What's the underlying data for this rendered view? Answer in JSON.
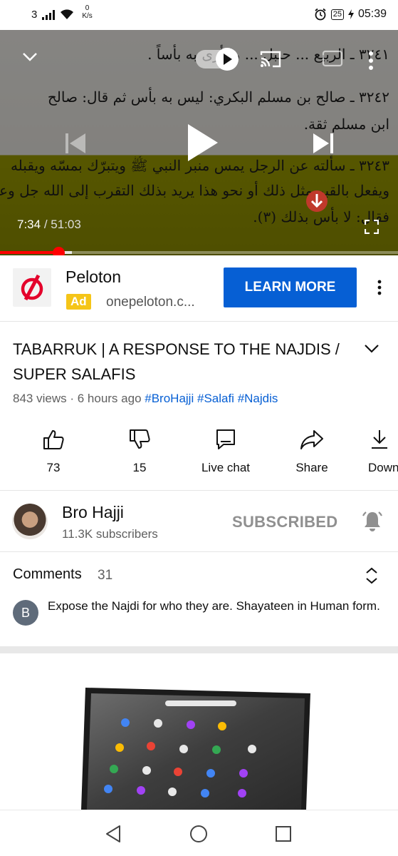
{
  "status_bar": {
    "sim": "3",
    "net_speed_value": "0",
    "net_speed_unit": "K/s",
    "battery": "25",
    "time": "05:39"
  },
  "player": {
    "arabic_lines": [
      "٣٢٤١ ـ الربيع ... حنبل ... ما أرى به بأساً .",
      "٣٢٤٢ ـ صالح بن مسلم البكري: ليس به بأس ثم قال: صالح",
      "ابن مسلم ثقة.",
      "٣٢٤٣ ـ سألته عن الرجل يمس منبر النبي ﷺ ويتبرّك بمسّه ويقبله",
      "ويفعل بالقبر مثل ذلك أو نحو هذا يريد بذلك التقرب إلى الله جل وعز",
      "فقال: لا بأس بذلك (٣)."
    ],
    "current_time": "7:34",
    "separator": "/",
    "duration": "51:03",
    "progress_fraction": 0.147,
    "buffered_fraction": 0.18
  },
  "ad": {
    "title": "Peloton",
    "badge": "Ad",
    "url": "onepeloton.c...",
    "cta": "LEARN MORE",
    "brand_color": "#e4002b"
  },
  "video": {
    "title": "TABARRUK | A RESPONSE TO THE NAJDIS / SUPER SALAFIS",
    "views": "843 views",
    "age": "6 hours ago",
    "hashtags": [
      "#BroHajji",
      "#Salafi",
      "#Najdis"
    ]
  },
  "actions": [
    {
      "label": "73",
      "icon": "thumbs-up-icon"
    },
    {
      "label": "15",
      "icon": "thumbs-down-icon"
    },
    {
      "label": "Live chat",
      "icon": "live-chat-icon"
    },
    {
      "label": "Share",
      "icon": "share-icon"
    },
    {
      "label": "Down",
      "icon": "download-icon"
    }
  ],
  "channel": {
    "name": "Bro Hajji",
    "subscribers": "11.3K subscribers",
    "subscribe_state": "SUBSCRIBED"
  },
  "comments": {
    "heading": "Comments",
    "count": "31",
    "top_comment": {
      "avatar_letter": "B",
      "text": "Expose the Najdi for who they are. Shayateen in Human form."
    }
  },
  "colors": {
    "accent_blue": "#065fd4",
    "progress_red": "#ff0000",
    "ad_badge_yellow": "#f5c518"
  }
}
